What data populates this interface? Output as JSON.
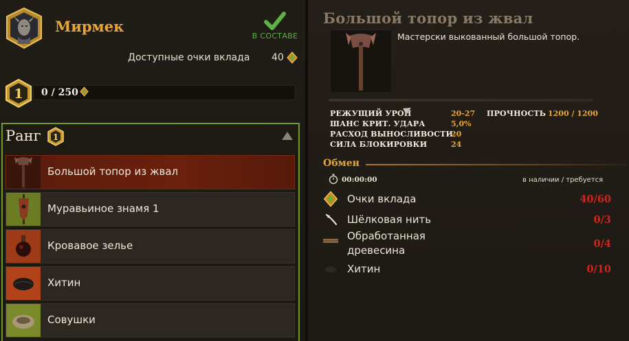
{
  "npc": {
    "name": "Мирмек",
    "status": "В СОСТАВЕ",
    "points_label": "Доступные очки вклада",
    "points_value": "40"
  },
  "progress": {
    "level": "1",
    "xp_text": "0 / 250",
    "fraction": 0.0
  },
  "rank": {
    "title": "Ранг",
    "badge": "1",
    "items": [
      {
        "label": "Большой топор из жвал",
        "selected": true,
        "icon": "axe-icon"
      },
      {
        "label": "Муравьиное знамя 1",
        "selected": false,
        "icon": "banner-icon"
      },
      {
        "label": "Кровавое зелье",
        "selected": false,
        "icon": "potion-icon"
      },
      {
        "label": "Хитин",
        "selected": false,
        "icon": "chitin-icon"
      },
      {
        "label": "Совушки",
        "selected": false,
        "icon": "nest-icon"
      }
    ]
  },
  "detail": {
    "title": "Большой топор из жвал",
    "description": "Мастерски выкованный большой топор.",
    "stats": [
      {
        "name": "РЕЖУЩИЙ УРОН",
        "value": "20-27"
      },
      {
        "name": "ШАНС КРИТ. УДАРА",
        "value": "5,0%"
      },
      {
        "name": "РАСХОД ВЫНОСЛИВОСТИ",
        "value": "20"
      },
      {
        "name": "СИЛА БЛОКИРОВКИ",
        "value": "24"
      }
    ],
    "durability": {
      "name": "ПРОЧНОСТЬ",
      "value": "1200 / 1200"
    }
  },
  "exchange": {
    "title": "Обмен",
    "timer": "00:00:00",
    "availability_label": "в наличии / требуется",
    "resources": [
      {
        "name": "Очки вклада",
        "qty": "40/60",
        "icon": "contribution-gem-icon"
      },
      {
        "name": "Шёлковая нить",
        "qty": "0/3",
        "icon": "silk-thread-icon"
      },
      {
        "name": "Обработанная древесина",
        "qty": "0/4",
        "icon": "wood-plank-icon"
      },
      {
        "name": "Хитин",
        "qty": "0/10",
        "icon": "chitin-icon"
      }
    ]
  },
  "colors": {
    "accent_gold": "#e8a63a",
    "status_green": "#5eb143",
    "shortage_red": "#c8281e",
    "rank_border": "#6f9a2c",
    "selected_row": "#5a1c0c"
  }
}
